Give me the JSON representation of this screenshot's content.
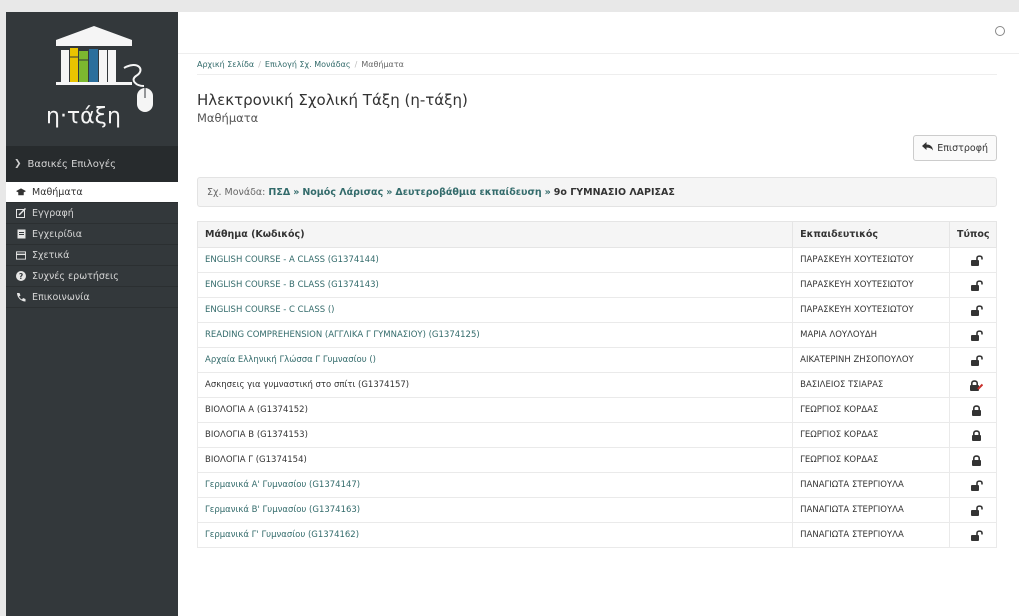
{
  "logo": {
    "text": "η·τάξη"
  },
  "sidebar": {
    "header": "Βασικές Επιλογές",
    "items": [
      {
        "label": "Μαθήματα",
        "icon": "graduation-cap-icon",
        "active": true
      },
      {
        "label": "Εγγραφή",
        "icon": "edit-icon",
        "active": false
      },
      {
        "label": "Εγχειρίδια",
        "icon": "file-icon",
        "active": false
      },
      {
        "label": "Σχετικά",
        "icon": "card-icon",
        "active": false
      },
      {
        "label": "Συχνές ερωτήσεις",
        "icon": "question-icon",
        "active": false
      },
      {
        "label": "Επικοινωνία",
        "icon": "phone-icon",
        "active": false
      }
    ]
  },
  "breadcrumb": {
    "home": "Αρχική Σελίδα",
    "select": "Επιλογή Σχ. Μονάδας",
    "current": "Μαθήματα",
    "separator": "/"
  },
  "page": {
    "title": "Ηλεκτρονική Σχολική Τάξη (η-τάξη)",
    "subtitle": "Μαθήματα",
    "back_label": "Επιστροφή"
  },
  "school": {
    "prefix": "Σχ. Μονάδα:",
    "path": [
      "ΠΣΔ",
      "Νομός Λάρισας",
      "Δευτεροβάθμια εκπαίδευση"
    ],
    "separator": "»",
    "last": "9ο ΓΥΜΝΑΣΙΟ ΛΑΡΙΣΑΣ"
  },
  "table": {
    "headers": [
      "Μάθημα (Κωδικός)",
      "Εκπαιδευτικός",
      "Τύπος"
    ],
    "rows": [
      {
        "name": "ENGLISH COURSE - A CLASS",
        "code": "(G1374144)",
        "teacher": "ΠΑΡΑΣΚΕΥΗ ΧΟΥΤΕΣΙΩΤΟΥ",
        "type": "open",
        "link": true
      },
      {
        "name": "ENGLISH COURSE - B CLASS",
        "code": "(G1374143)",
        "teacher": "ΠΑΡΑΣΚΕΥΗ ΧΟΥΤΕΣΙΩΤΟΥ",
        "type": "open",
        "link": true
      },
      {
        "name": "ENGLISH COURSE - C CLASS",
        "code": "()",
        "teacher": "ΠΑΡΑΣΚΕΥΗ ΧΟΥΤΕΣΙΩΤΟΥ",
        "type": "open",
        "link": true
      },
      {
        "name": "READING COMPREHENSION (ΑΓΓΛΙΚΑ Γ ΓΥΜΝΑΣΙΟΥ)",
        "code": "(G1374125)",
        "teacher": "ΜΑΡΙΑ ΛΟΥΛΟΥΔΗ",
        "type": "open",
        "link": true
      },
      {
        "name": "Αρχαία Ελληνική Γλώσσα Γ Γυμνασίου",
        "code": "()",
        "teacher": "ΑΙΚΑΤΕΡΙΝΗ ΖΗΣΟΠΟΥΛΟΥ",
        "type": "open",
        "link": true
      },
      {
        "name": "Ασκησεις για γυμναστική στο σπίτι",
        "code": "(G1374157)",
        "teacher": "ΒΑΣΙΛΕΙΟΣ ΤΣΙΑΡΑΣ",
        "type": "registration",
        "link": false
      },
      {
        "name": "ΒΙΟΛΟΓΙΑ Α",
        "code": "(G1374152)",
        "teacher": "ΓΕΩΡΓΙΟΣ ΚΟΡΔΑΣ",
        "type": "closed",
        "link": false
      },
      {
        "name": "ΒΙΟΛΟΓΙΑ Β",
        "code": "(G1374153)",
        "teacher": "ΓΕΩΡΓΙΟΣ ΚΟΡΔΑΣ",
        "type": "closed",
        "link": false
      },
      {
        "name": "ΒΙΟΛΟΓΙΑ Γ",
        "code": "(G1374154)",
        "teacher": "ΓΕΩΡΓΙΟΣ ΚΟΡΔΑΣ",
        "type": "closed",
        "link": false
      },
      {
        "name": "Γερμανικά Α' Γυμνασίου",
        "code": "(G1374147)",
        "teacher": "ΠΑΝΑΓΙΩΤΑ ΣΤΕΡΓΙΟΥΛΑ",
        "type": "open",
        "link": true
      },
      {
        "name": "Γερμανικά Β' Γυμνασίου",
        "code": "(G1374163)",
        "teacher": "ΠΑΝΑΓΙΩΤΑ ΣΤΕΡΓΙΟΥΛΑ",
        "type": "open",
        "link": true
      },
      {
        "name": "Γερμανικά Γ' Γυμνασίου",
        "code": "(G1374162)",
        "teacher": "ΠΑΝΑΓΙΩΤΑ ΣΤΕΡΓΙΟΥΛΑ",
        "type": "open",
        "link": true
      }
    ]
  },
  "colors": {
    "sidebar": "#33383b",
    "sidebar_header": "#272b2d",
    "link": "#336b6b",
    "lock_red": "#c9302c"
  }
}
